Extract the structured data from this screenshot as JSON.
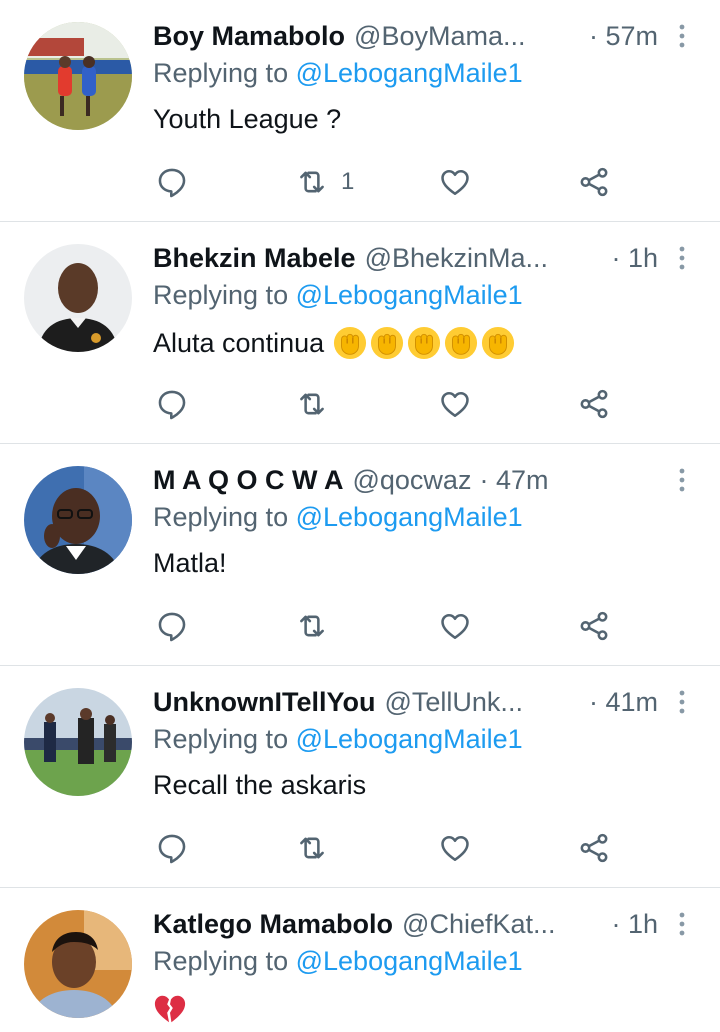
{
  "colors": {
    "accent": "#1d9bf0",
    "muted": "#536471",
    "text": "#0f1419",
    "divider": "#dfe3e6"
  },
  "icons": {
    "reply": "speech-bubble-icon",
    "retweet": "retweet-icon",
    "like": "heart-icon",
    "share": "share-icon",
    "more": "vertical-ellipsis-icon"
  },
  "tweets": [
    {
      "name": "Boy Mamabolo",
      "handle": "@BoyMama...",
      "time": "· 57m",
      "replying_prefix": "Replying to",
      "replying_to": "@LebogangMaile1",
      "text": "Youth League ?",
      "retweet_count": "1"
    },
    {
      "name": "Bhekzin Mabele",
      "handle": "@BhekzinMa...",
      "time": "· 1h",
      "replying_prefix": "Replying to",
      "replying_to": "@LebogangMaile1",
      "text": "Aluta continua",
      "emoji": [
        "raised-fist-emoji",
        "raised-fist-emoji",
        "raised-fist-emoji",
        "raised-fist-emoji",
        "raised-fist-emoji"
      ],
      "retweet_count": ""
    },
    {
      "name": "M A Q O C W A",
      "handle": "@qocwaz",
      "time": "· 47m",
      "replying_prefix": "Replying to",
      "replying_to": "@LebogangMaile1",
      "text": "Matla!",
      "retweet_count": ""
    },
    {
      "name": "UnknownITellYou",
      "handle": "@TellUnk...",
      "time": "· 41m",
      "replying_prefix": "Replying to",
      "replying_to": "@LebogangMaile1",
      "text": "Recall the askaris",
      "retweet_count": ""
    },
    {
      "name": "Katlego Mamabolo",
      "handle": "@ChiefKat...",
      "time": "· 1h",
      "replying_prefix": "Replying to",
      "replying_to": "@LebogangMaile1",
      "text": "",
      "emoji": [
        "broken-heart-emoji"
      ]
    }
  ]
}
